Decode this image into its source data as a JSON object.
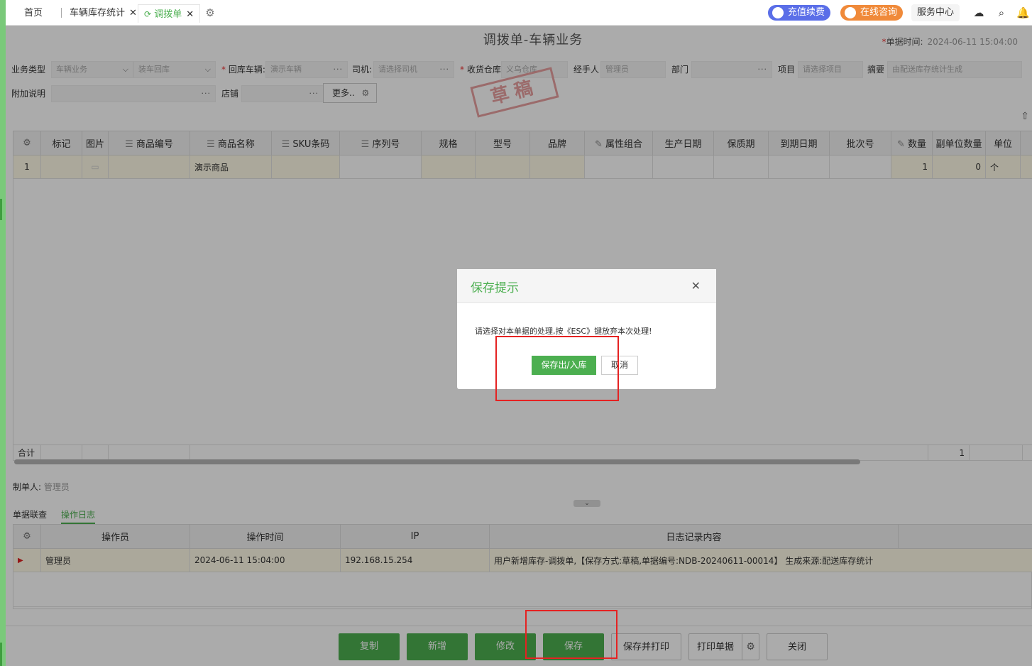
{
  "tabs": [
    {
      "label": "首页"
    },
    {
      "label": "车辆库存统计"
    },
    {
      "label": "调拨单"
    }
  ],
  "topbar": {
    "recharge": "充值续费",
    "consult": "在线咨询",
    "service": "服务中心"
  },
  "form": {
    "title": "调拨单-车辆业务",
    "doc_time_label": "单据时间:",
    "doc_time_value": "2024-06-11 15:04:00",
    "biz_type_label": "业务类型",
    "biz_type_value": "车辆业务",
    "biz_sub_value": "装车回库",
    "vehicle_label": "回库车辆:",
    "vehicle_value": "演示车辆",
    "driver_label": "司机:",
    "driver_placeholder": "请选择司机",
    "warehouse_label": "收货仓库",
    "warehouse_value": "义乌仓库",
    "handler_label": "经手人",
    "handler_value": "管理员",
    "dept_label": "部门",
    "project_label": "项目",
    "project_placeholder": "请选择项目",
    "summary_label": "摘要",
    "summary_value": "由配送库存统计生成",
    "note_label": "附加说明",
    "shop_label": "店铺",
    "more_label": "更多.."
  },
  "stamp": "草稿",
  "grid": {
    "columns": [
      "标记",
      "图片",
      "商品编号",
      "商品名称",
      "SKU条码",
      "序列号",
      "规格",
      "型号",
      "品牌",
      "属性组合",
      "生产日期",
      "保质期",
      "到期日期",
      "批次号",
      "数量",
      "副单位数量",
      "单位"
    ],
    "rows": [
      {
        "no": "1",
        "name": "演示商品",
        "qty": "1",
        "subqty": "0",
        "unit": "个"
      }
    ],
    "sum_label": "合计",
    "sum_qty": "1"
  },
  "maker": {
    "label": "制单人:",
    "value": "管理员"
  },
  "bottom_tabs": [
    "单据联查",
    "操作日志"
  ],
  "log": {
    "columns": [
      "操作员",
      "操作时间",
      "IP",
      "日志记录内容"
    ],
    "rows": [
      {
        "operator": "管理员",
        "time": "2024-06-11 15:04:00",
        "ip": "192.168.15.254",
        "content": "用户新增库存-调拨单,【保存方式:草稿,单据编号:NDB-20240611-00014】 生成来源:配送库存统计"
      }
    ]
  },
  "footer_buttons": {
    "copy": "复制",
    "new": "新增",
    "edit": "修改",
    "save": "保存",
    "save_print": "保存并打印",
    "print": "打印单据",
    "close": "关闭"
  },
  "modal": {
    "title": "保存提示",
    "message": "请选择对本单据的处理,按《ESC》键放弃本次处理!",
    "save_label": "保存出/入库",
    "cancel_label": "取消"
  },
  "colors": {
    "accent": "#4caf50",
    "highlight": "#e52222"
  }
}
